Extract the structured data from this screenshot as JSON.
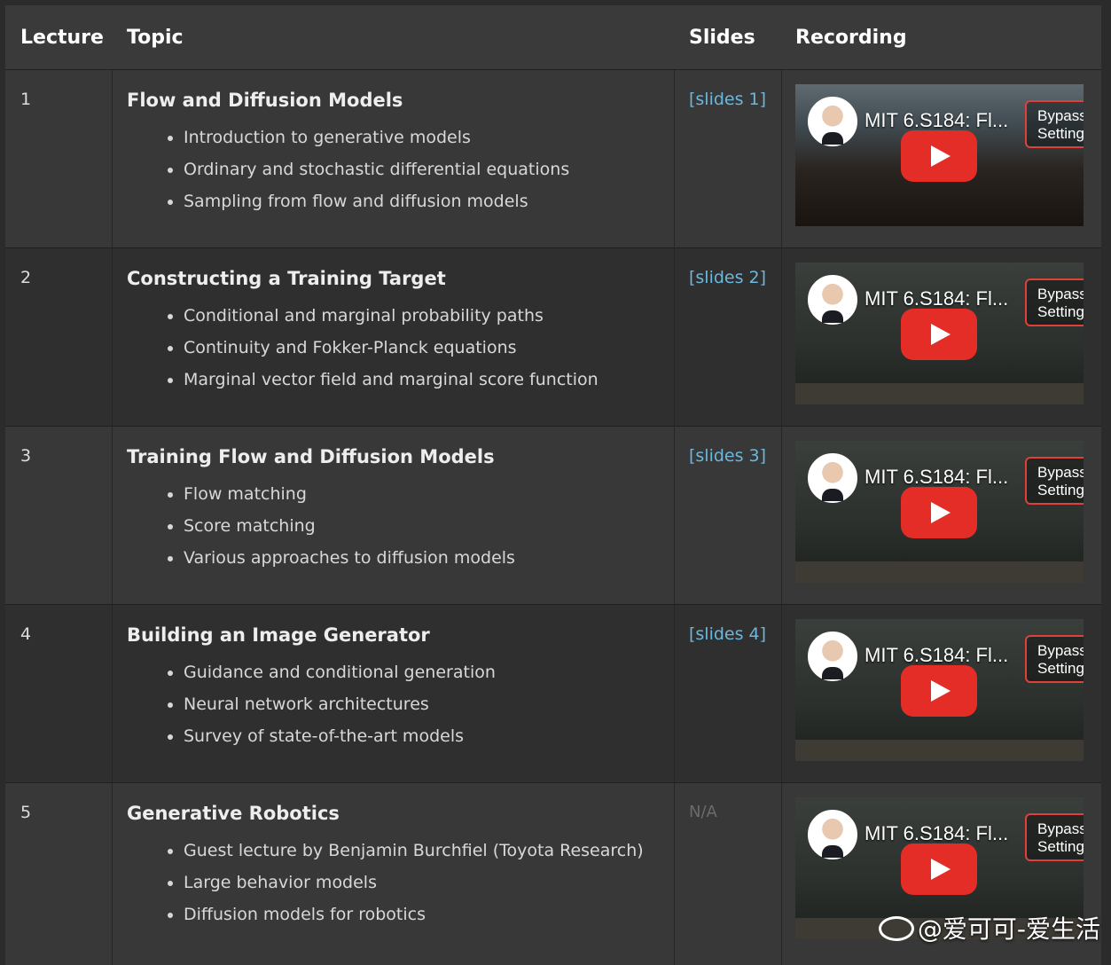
{
  "header": {
    "lecture": "Lecture",
    "topic": "Topic",
    "slides": "Slides",
    "recording": "Recording"
  },
  "rows": [
    {
      "number": "1",
      "title": "Flow and Diffusion Models",
      "bullets": [
        "Introduction to generative models",
        "Ordinary and stochastic differential equations",
        "Sampling from flow and diffusion models"
      ],
      "slides": "[slides 1]",
      "video_title": "MIT 6.S184: Fl...",
      "bypass": "Bypass Setting"
    },
    {
      "number": "2",
      "title": "Constructing a Training Target",
      "bullets": [
        "Conditional and marginal probability paths",
        "Continuity and Fokker-Planck equations",
        "Marginal vector field and marginal score function"
      ],
      "slides": "[slides 2]",
      "video_title": "MIT 6.S184: Fl...",
      "bypass": "Bypass Setting"
    },
    {
      "number": "3",
      "title": "Training Flow and Diffusion Models",
      "bullets": [
        "Flow matching",
        "Score matching",
        "Various approaches to diffusion models"
      ],
      "slides": "[slides 3]",
      "video_title": "MIT 6.S184: Fl...",
      "bypass": "Bypass Setting"
    },
    {
      "number": "4",
      "title": "Building an Image Generator",
      "bullets": [
        "Guidance and conditional generation",
        "Neural network architectures",
        "Survey of state-of-the-art models"
      ],
      "slides": "[slides 4]",
      "video_title": "MIT 6.S184: Fl...",
      "bypass": "Bypass Setting"
    },
    {
      "number": "5",
      "title": "Generative Robotics",
      "bullets": [
        "Guest lecture by Benjamin Burchfiel (Toyota Research)",
        "Large behavior models",
        "Diffusion models for robotics"
      ],
      "slides": "N/A",
      "video_title": "MIT 6.S184: Fl...",
      "bypass": "Bypass Setting"
    }
  ],
  "watermark": "@爱可可-爱生活",
  "icons": {
    "play": "youtube-play-icon",
    "bullet": "disc-bullet-icon",
    "watermark": "weibo-icon"
  },
  "colors": {
    "link": "#6db7dc",
    "play_button": "#e52d27",
    "background": "#2b2b2b"
  }
}
